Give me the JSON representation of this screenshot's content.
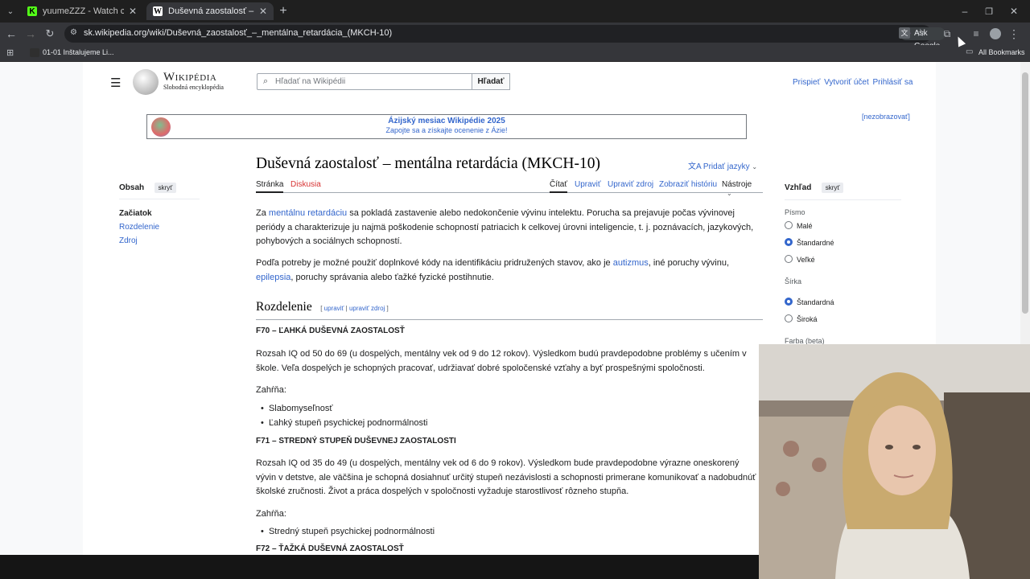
{
  "browser": {
    "tabs": [
      {
        "title": "yuumeZZZ - Watch clips on Kic",
        "favicon": "K",
        "active": false
      },
      {
        "title": "Duševná zaostalosť – mentálna",
        "favicon": "W",
        "active": true
      }
    ],
    "url": "sk.wikipedia.org/wiki/Duševná_zaostalosť_–_mentálna_retardácia_(MKCH-10)",
    "ask_google": "Ask Google",
    "bookmark_item": "01-01 Inštalujeme Li...",
    "all_bookmarks": "All Bookmarks",
    "icons": [
      "back-icon",
      "forward-icon",
      "reload-icon",
      "site-info-icon",
      "translate-icon",
      "star-icon",
      "extensions-icon",
      "media-icon",
      "profile-icon",
      "menu-icon"
    ]
  },
  "wiki": {
    "logo_title": "Wikipédia",
    "logo_subtitle": "Slobodná encyklopédia",
    "search_placeholder": "Hľadať na Wikipédii",
    "search_button": "Hľadať",
    "user_links": {
      "contribute": "Prispieť",
      "create_account": "Vytvoriť účet",
      "login": "Prihlásiť sa"
    },
    "banner": {
      "line1": "Ázijský mesiac Wikipédie 2025",
      "line2": "Zapojte sa a získajte ocenenie z Ázie!",
      "hide": "[nezobrazovať]"
    },
    "title": "Duševná zaostalosť – mentálna retardácia (MKCH-10)",
    "add_languages": "Pridať jazyky",
    "tabs_left": [
      "Stránka",
      "Diskusia"
    ],
    "tabs_right": [
      "Čítať",
      "Upraviť",
      "Upraviť zdroj",
      "Zobraziť históriu",
      "Nástroje"
    ],
    "toc": {
      "heading": "Obsah",
      "hide": "skryť",
      "items": [
        "Začiatok",
        "Rozdelenie",
        "Zdroj"
      ]
    },
    "appearance": {
      "heading": "Vzhľad",
      "hide": "skryť",
      "font_label": "Písmo",
      "font_options": [
        "Malé",
        "Štandardné",
        "Veľké"
      ],
      "font_selected": "Štandardné",
      "width_label": "Šírka",
      "width_options": [
        "Štandardná",
        "Široká"
      ],
      "width_selected": "Štandardná",
      "color_label": "Farba (beta)"
    },
    "intro": {
      "p1_pre": "Za ",
      "p1_link": "mentálnu retardáciu",
      "p1_post": " sa pokladá zastavenie alebo nedokončenie vývinu intelektu. Porucha sa prejavuje počas vývinovej periódy a charakterizuje ju najmä poškodenie schopností patriacich k celkovej úrovni inteligencie, t. j. poznávacích, jazykových, pohybových a sociálnych schopností.",
      "p2_pre": "Podľa potreby je možné použiť doplnkové kódy na identifikáciu pridružených stavov, ako je ",
      "p2_link1": "autizmus",
      "p2_mid": ", iné poruchy vývinu, ",
      "p2_link2": "epilepsia",
      "p2_post": ", poruchy správania alebo ťažké fyzické postihnutie."
    },
    "section": {
      "heading": "Rozdelenie",
      "edit1": "upraviť",
      "edit2": "upraviť zdroj"
    },
    "f70": {
      "heading": "F70 – ĽAHKÁ DUŠEVNÁ ZAOSTALOSŤ",
      "text": "Rozsah IQ od 50 do 69 (u dospelých, mentálny vek od 9 do 12 rokov). Výsledkom budú pravdepodobne problémy s učením v škole. Veľa dospelých je schopných pracovať, udržiavať dobré spoločenské vzťahy a byť prospešnými spoločnosti.",
      "includes": "Zahŕňa:",
      "items": [
        "Slabomyseľnosť",
        "Ľahký stupeň psychickej podnormálnosti"
      ]
    },
    "f71": {
      "heading": "F71 – STREDNÝ STUPEŇ DUŠEVNEJ ZAOSTALOSTI",
      "text": "Rozsah IQ od 35 do 49 (u dospelých, mentálny vek od 6 do 9 rokov). Výsledkom bude pravdepodobne výrazne oneskorený vývin v detstve, ale väčšina je schopná dosiahnuť určitý stupeň nezávislosti a schopnosti primerane komunikovať a nadobudnúť školské zručnosti. Život a práca dospelých v spoločnosti vyžaduje starostlivosť rôzneho stupňa.",
      "includes": "Zahŕňa:",
      "items": [
        "Stredný stupeň psychickej podnormálnosti"
      ]
    },
    "f72": {
      "heading": "F72 – ŤAŽKÁ DUŠEVNÁ ZAOSTALOSŤ"
    }
  }
}
